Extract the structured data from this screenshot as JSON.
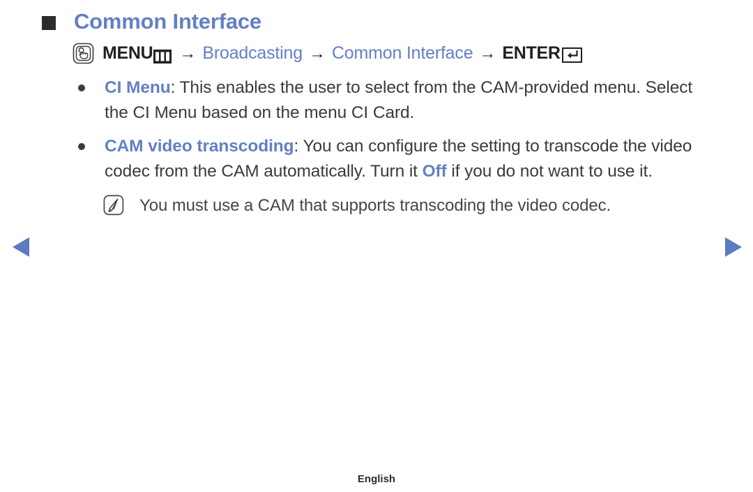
{
  "header": {
    "bullet_icon": "filled-square-icon",
    "title": "Common Interface"
  },
  "menu_path": {
    "press_icon": "menu-press-hand-icon",
    "menu_label": "MENU",
    "menu_box_icon": "menu-grid-icon",
    "separator": "→",
    "step_broadcasting": "Broadcasting",
    "step_common_interface": "Common Interface",
    "enter_label": "ENTER",
    "enter_icon": "enter-return-arrow-icon"
  },
  "bullets": [
    {
      "dot_icon": "bullet-dot-icon",
      "keyword": "CI Menu",
      "text_after_keyword": ": This enables the user to select from the CAM-provided menu. Select the CI Menu based on the menu CI Card."
    },
    {
      "dot_icon": "bullet-dot-icon",
      "keyword": "CAM video transcoding",
      "text_part1": ": You can configure the setting to transcode the video codec from the CAM automatically. Turn it ",
      "inline_keyword": "Off",
      "text_part2": " if you do not want to use it."
    }
  ],
  "note": {
    "icon": "note-pencil-icon",
    "text": "You must use a CAM that supports transcoding the video codec."
  },
  "navigation": {
    "prev_icon": "triangle-left-icon",
    "next_icon": "triangle-right-icon",
    "accent_color": "#5b7ac0"
  },
  "footer": {
    "language": "English"
  },
  "colors": {
    "accent_blue": "#6380c4",
    "text_dark": "#3d3a3a",
    "header_square": "#2e2b2b"
  }
}
